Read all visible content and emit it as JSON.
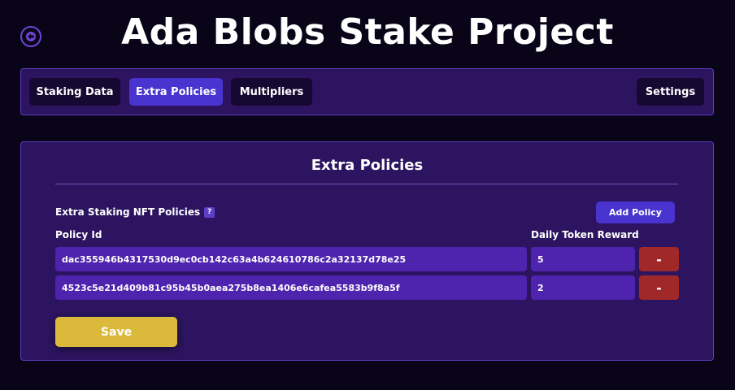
{
  "header": {
    "title": "Ada Blobs Stake Project",
    "back_icon": "back-arrow-icon"
  },
  "nav": {
    "tabs": [
      {
        "label": "Staking Data",
        "active": false
      },
      {
        "label": "Extra Policies",
        "active": true
      },
      {
        "label": "Multipliers",
        "active": false
      }
    ],
    "settings_label": "Settings"
  },
  "panel": {
    "title": "Extra Policies",
    "section_label": "Extra Staking NFT Policies",
    "help_glyph": "?",
    "add_button_label": "Add Policy",
    "columns": {
      "policy_id": "Policy Id",
      "daily_reward": "Daily Token Reward"
    },
    "rows": [
      {
        "policy_id": "dac355946b4317530d9ec0cb142c63a4b624610786c2a32137d78e25",
        "reward": "5",
        "remove_label": "-"
      },
      {
        "policy_id": "4523c5e21d409b81c95b45b0aea275b8ea1406e6cafea5583b9f8a5f",
        "reward": "2",
        "remove_label": "-"
      }
    ],
    "save_label": "Save"
  },
  "colors": {
    "background": "#0a0419",
    "panel": "#2c1460",
    "accent": "#4a34cf",
    "input": "#4e23ad",
    "danger": "#a02828",
    "save": "#dbb93a"
  }
}
